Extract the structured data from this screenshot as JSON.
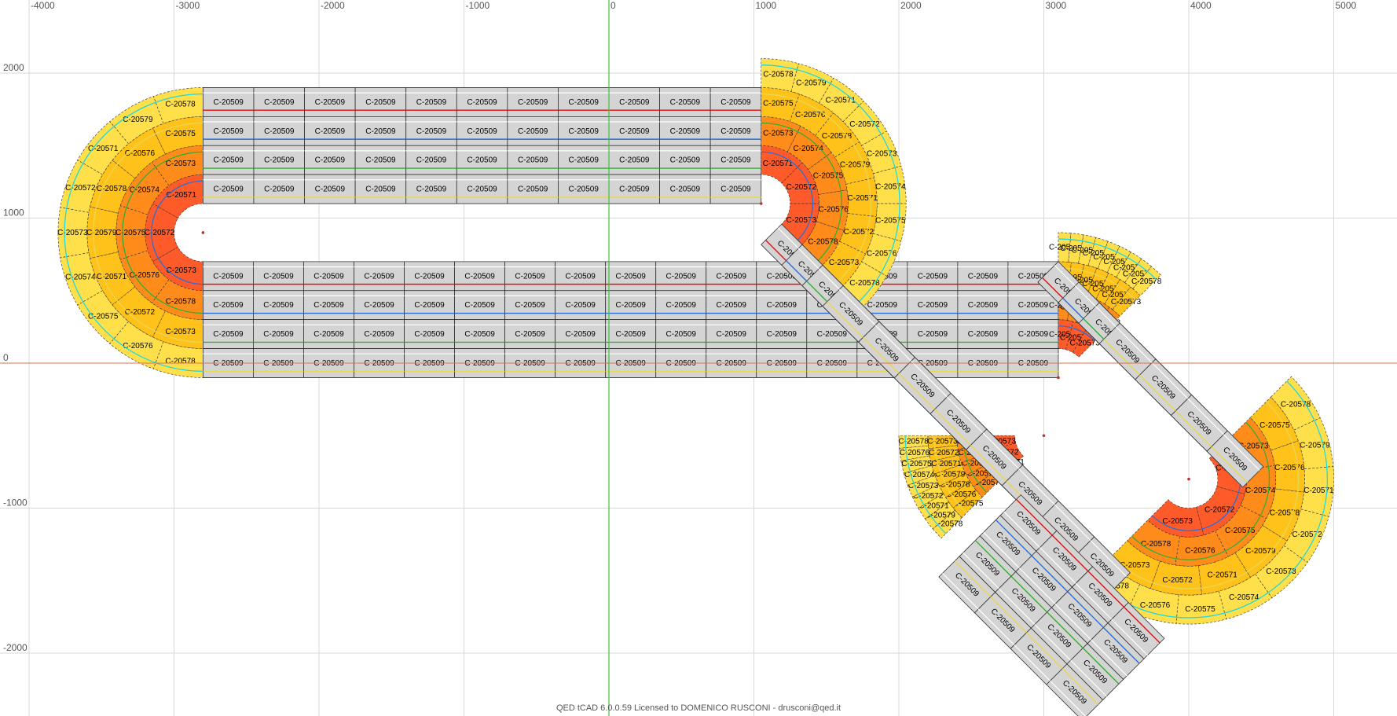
{
  "colors": {
    "grid": "#d8d8d8",
    "axis_x": "#e07050",
    "axis_y": "#40c040",
    "tile": "#d4d4d4",
    "tile_border": "#303030",
    "curve_r1": "#ff5a2a",
    "curve_r2": "#ff8c1a",
    "curve_r3": "#ffc21a",
    "curve_r4": "#ffe04a",
    "lane": [
      "#e01010",
      "#2a6fd6",
      "#30b030",
      "#e8d850",
      "#20d8e0",
      "#e020e0"
    ]
  },
  "axes": {
    "x_ticks": [
      "-4000",
      "-3000",
      "-2000",
      "-1000",
      "0",
      "1000",
      "2000",
      "3000",
      "4000",
      "5000"
    ],
    "y_ticks": [
      "2000",
      "1000",
      "0",
      "-1000",
      "-2000"
    ]
  },
  "labels": {
    "straight": "C-20509",
    "curves": [
      "C-20571",
      "C-20572",
      "C-20573",
      "C-20574",
      "C-20575",
      "C-20576",
      "C-20578",
      "C-20579"
    ],
    "sample_curve_text": [
      "C-20579",
      "C-20579",
      "C-20576",
      "C-20575",
      "C-20574",
      "C-20578",
      "C-20573",
      "C-20572",
      "C-20571",
      "C-2057",
      "C-2057I",
      "C-20579I"
    ]
  },
  "footer": "QED tCAD 6.0.0.59 Licensed to DOMENICO RUSCONI - drusconi@qed.it"
}
